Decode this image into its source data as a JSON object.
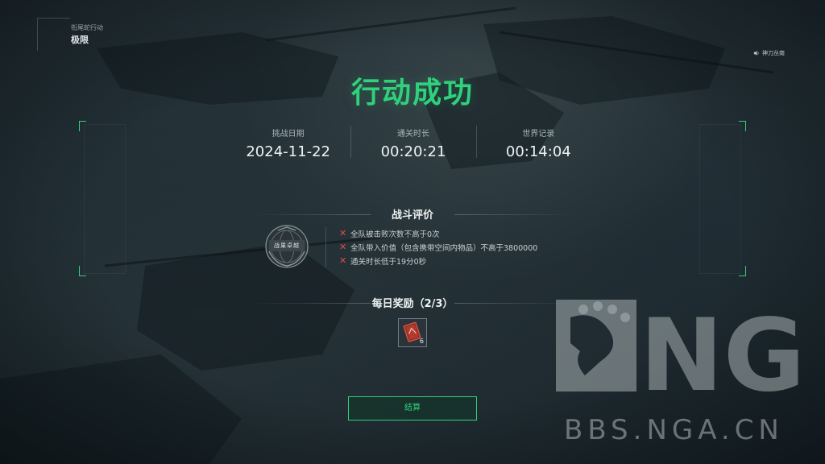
{
  "mission": {
    "name": "衔尾蛇行动",
    "difficulty": "极限"
  },
  "music": {
    "icon": "speaker-icon",
    "track": "神刀丛南"
  },
  "result_title": "行动成功",
  "stats": [
    {
      "label": "挑战日期",
      "value": "2024-11-22"
    },
    {
      "label": "通关时长",
      "value": "00:20:21"
    },
    {
      "label": "世界记录",
      "value": "00:14:04"
    }
  ],
  "evaluation": {
    "heading": "战斗评价",
    "emblem_text": "战果卓越",
    "conditions": [
      {
        "status": "failed",
        "icon": "cross-icon",
        "text": "全队被击败次数不高于0次"
      },
      {
        "status": "failed",
        "icon": "cross-icon",
        "text": "全队带入价值（包含携带空间内物品）不高于3800000"
      },
      {
        "status": "failed",
        "icon": "cross-icon",
        "text": "通关时长低于19分0秒"
      }
    ]
  },
  "daily_reward": {
    "heading": "每日奖励（2/3）",
    "items": [
      {
        "icon": "red-ticket-icon",
        "count": "6"
      }
    ]
  },
  "settle_button": "结算",
  "watermark": {
    "logo_text": "NGA",
    "site": "BBS.NGA.CN"
  },
  "colors": {
    "accent": "#2fd17c",
    "fail": "#e24a45",
    "background": "#1f2c33"
  }
}
